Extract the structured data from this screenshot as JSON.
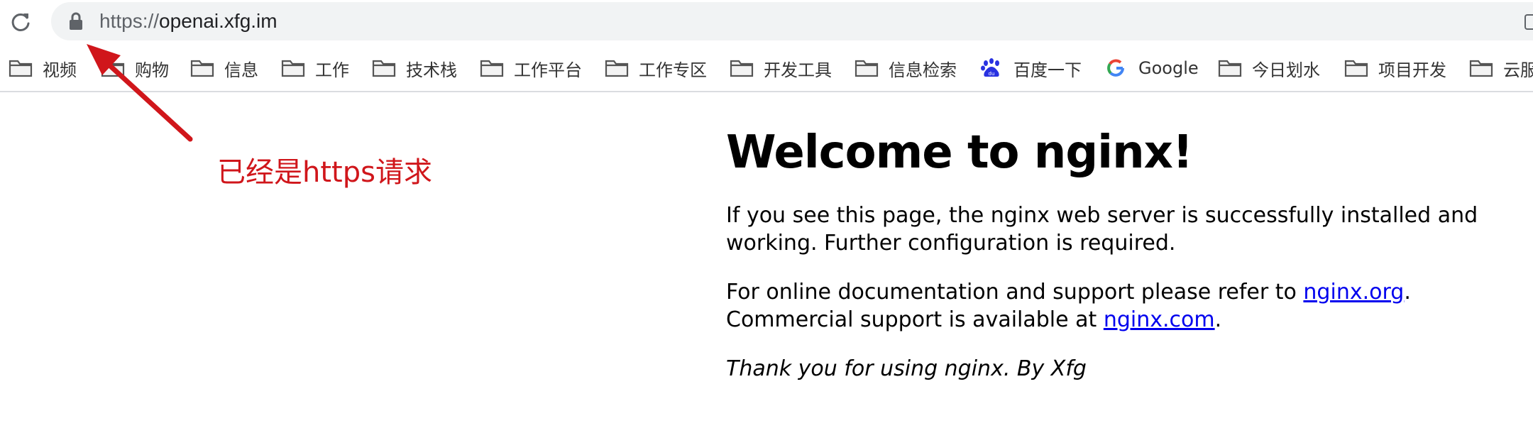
{
  "browser": {
    "url_scheme": "https://",
    "url_host": "openai.xfg.im"
  },
  "bookmarks": [
    {
      "label": "视频",
      "icon": "folder-icon"
    },
    {
      "label": "购物",
      "icon": "folder-icon"
    },
    {
      "label": "信息",
      "icon": "folder-icon"
    },
    {
      "label": "工作",
      "icon": "folder-icon"
    },
    {
      "label": "技术栈",
      "icon": "folder-icon"
    },
    {
      "label": "工作平台",
      "icon": "folder-icon"
    },
    {
      "label": "工作专区",
      "icon": "folder-icon"
    },
    {
      "label": "开发工具",
      "icon": "folder-icon"
    },
    {
      "label": "信息检索",
      "icon": "folder-icon"
    },
    {
      "label": "百度一下",
      "icon": "baidu-icon"
    },
    {
      "label": "Google",
      "icon": "google-icon"
    },
    {
      "label": "今日划水",
      "icon": "folder-icon"
    },
    {
      "label": "项目开发",
      "icon": "folder-icon"
    },
    {
      "label": "云服",
      "icon": "folder-icon"
    }
  ],
  "annotation": {
    "text": "已经是https请求",
    "color": "#d0161b"
  },
  "page": {
    "heading": "Welcome to nginx!",
    "para1": "If you see this page, the nginx web server is successfully installed and working. Further configuration is required.",
    "para2_prefix": "For online documentation and support please refer to ",
    "link_org": "nginx.org",
    "para2_mid": ".",
    "para2_line2_prefix": "Commercial support is available at ",
    "link_com": "nginx.com",
    "para2_suffix": ".",
    "para3": "Thank you for using nginx. By Xfg",
    "link_color": "#0000ee"
  }
}
